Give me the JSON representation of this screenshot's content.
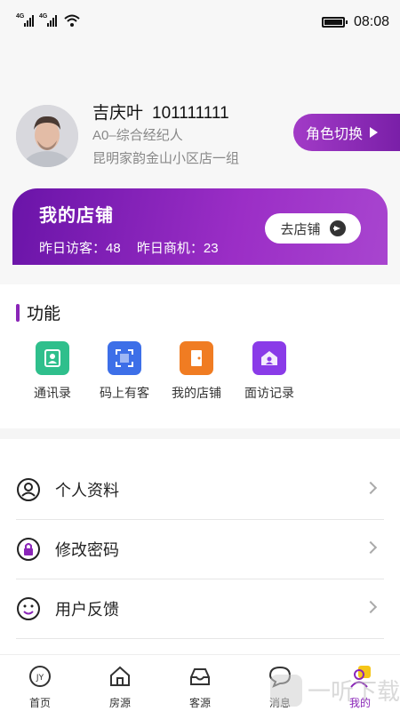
{
  "status_bar": {
    "network_1": "4G",
    "network_2": "4G",
    "time": "08:08"
  },
  "profile": {
    "name": "吉庆叶",
    "id": "101111111",
    "role": "A0–综合经纪人",
    "store": "昆明家韵金山小区店一组",
    "role_switch_label": "角色切换"
  },
  "store_card": {
    "title": "我的店铺",
    "visitors_label": "昨日访客：48",
    "leads_label": "昨日商机：23",
    "go_store_label": "去店铺"
  },
  "functions": {
    "title": "功能",
    "items": [
      {
        "label": "通讯录",
        "icon": "contacts-icon",
        "color": "#2fbf8c"
      },
      {
        "label": "码上有客",
        "icon": "scan-icon",
        "color": "#3d6fe8"
      },
      {
        "label": "我的店铺",
        "icon": "door-icon",
        "color": "#f07c22"
      },
      {
        "label": "面访记录",
        "icon": "house-record-icon",
        "color": "#8a3be8"
      }
    ]
  },
  "menu": [
    {
      "label": "个人资料",
      "icon": "user-circle-icon"
    },
    {
      "label": "修改密码",
      "icon": "lock-icon"
    },
    {
      "label": "用户反馈",
      "icon": "smile-icon"
    }
  ],
  "tabbar": {
    "items": [
      {
        "label": "首页",
        "icon": "jy-logo-icon"
      },
      {
        "label": "房源",
        "icon": "house-icon"
      },
      {
        "label": "客源",
        "icon": "inbox-icon"
      },
      {
        "label": "消息",
        "icon": "chat-icon"
      },
      {
        "label": "我的",
        "icon": "profile-icon"
      }
    ],
    "active_index": 4
  },
  "watermark": {
    "text": "一听下载"
  },
  "colors": {
    "accent": "#8a25b8",
    "accent_light": "#a845cf"
  }
}
